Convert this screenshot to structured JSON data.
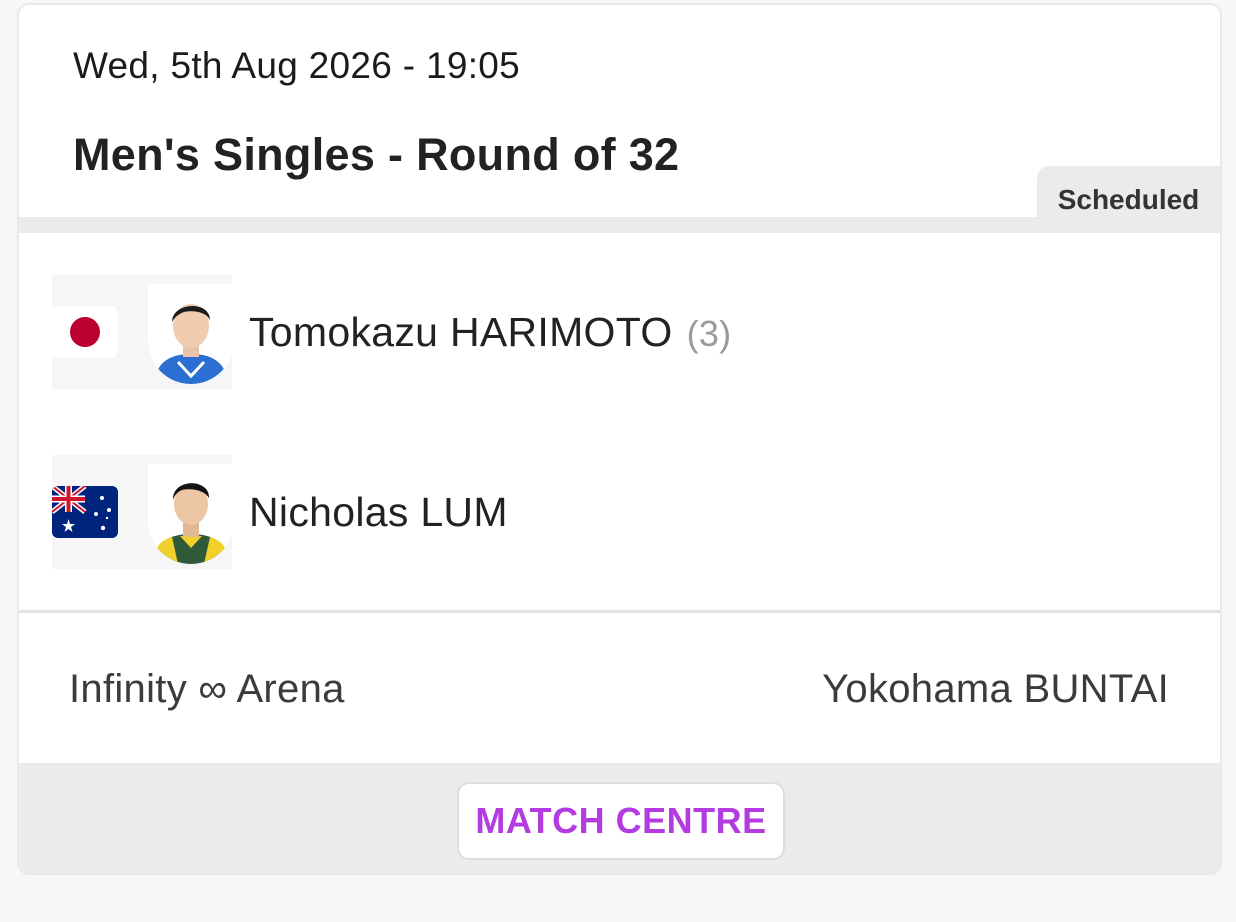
{
  "match": {
    "datetime": "Wed, 5th Aug 2026 - 19:05",
    "event": "Men's Singles - Round of 32",
    "status": "Scheduled"
  },
  "players": [
    {
      "name": "Tomokazu HARIMOTO",
      "seed": "(3)",
      "flag": "japan-flag-icon",
      "avatar": "player-photo"
    },
    {
      "name": "Nicholas LUM",
      "seed": "",
      "flag": "australia-flag-icon",
      "avatar": "player-photo"
    }
  ],
  "venue": {
    "arena": "Infinity ∞ Arena",
    "city": "Yokohama BUNTAI"
  },
  "footer": {
    "button_label": "MATCH CENTRE"
  },
  "colors": {
    "accent": "#b33be0",
    "japan_red": "#bc002d",
    "australia_blue": "#00247d",
    "divider": "#ebebeb"
  }
}
